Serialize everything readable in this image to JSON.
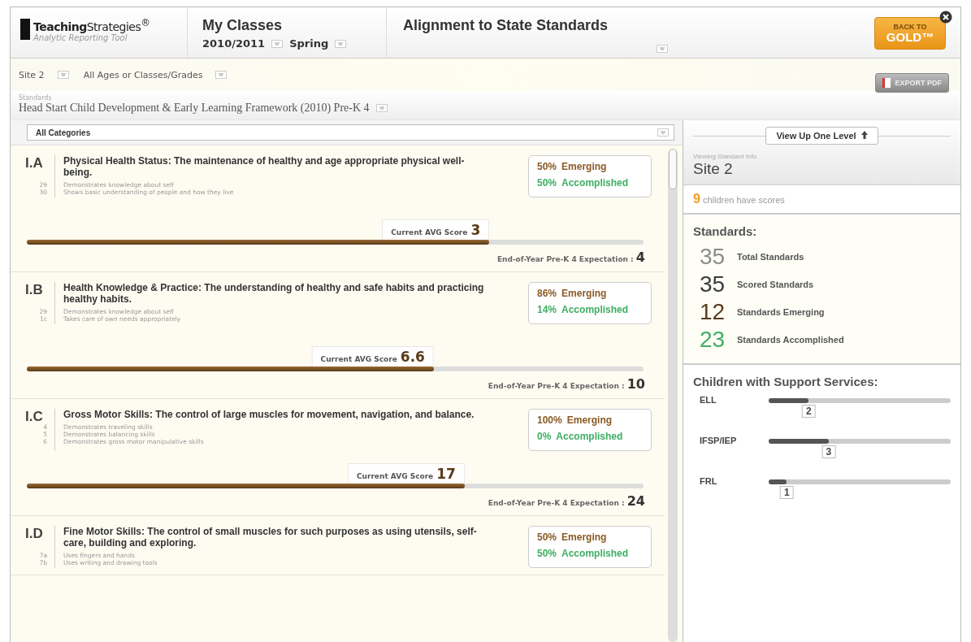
{
  "header": {
    "logo": "**Teaching**Strategies$^{®}$",
    "tagline": "Analytic Reporting Tool",
    "section_title": "My Classes",
    "year": "2010/2011",
    "term": "Spring",
    "report_title": "Alignment to State Standards",
    "back_button": [
      "BACK TO",
      "GOLD™"
    ]
  },
  "filters": [
    "Site 2",
    "All Ages or Classes/Grades"
  ],
  "export_button": "EXPORT PDF",
  "standards": {
    "label": "Standards",
    "value": "Head Start Child Development & Early Learning Framework (2010) Pre-K 4"
  },
  "category_select": "All Categories",
  "cards": [
    {
      "code": "I.A",
      "title": "Physical Health Status:  The maintenance of healthy and age appropriate physical well-being.",
      "indicators": [
        {
          "number": "29",
          "text": "Demonstrates knowledge about self"
        },
        {
          "number": "30",
          "text": "Shows basic understanding of people and how they live"
        }
      ],
      "emerging": "50%",
      "emerging_label": "Emerging",
      "accomplished": "50%",
      "accomplished_label": "Accomplished",
      "score_label": "Current AVG Score",
      "score": "3",
      "level": 0.75,
      "expectation_label": "End-of-Year Pre-K 4 Expectation :",
      "expectation": "4"
    },
    {
      "code": "I.B",
      "title": "Health Knowledge & Practice:  The understanding of healthy and safe habits and practicing healthy habits.",
      "indicators": [
        {
          "number": "29",
          "text": "Demonstrates knowledge about self"
        },
        {
          "number": "1c",
          "text": "Takes care of own needs appropriately"
        }
      ],
      "emerging": "86%",
      "emerging_label": "Emerging",
      "accomplished": "14%",
      "accomplished_label": "Accomplished",
      "score_label": "Current AVG Score",
      "score": "6.6",
      "level": 0.66,
      "expectation_label": "End-of-Year Pre-K 4 Expectation :",
      "expectation": "10"
    },
    {
      "code": "I.C",
      "title": "Gross Motor Skills:  The control of large muscles for movement, navigation, and balance.",
      "indicators": [
        {
          "number": "4",
          "text": "Demonstrates traveling skills"
        },
        {
          "number": "5",
          "text": "Demonstrates balancing skills"
        },
        {
          "number": "6",
          "text": "Demonstrates gross motor manipulative skills"
        }
      ],
      "emerging": "100%",
      "emerging_label": "Emerging",
      "accomplished": "0%",
      "accomplished_label": "Accomplished",
      "score_label": "Current AVG Score",
      "score": "17",
      "level": 0.71,
      "expectation_label": "End-of-Year Pre-K 4 Expectation :",
      "expectation": "24"
    },
    {
      "code": "I.D",
      "title": "Fine Motor Skills:  The control of small muscles for such purposes as using utensils, self-care, building and exploring.",
      "indicators": [
        {
          "number": "7a",
          "text": "Uses fingers and hands"
        },
        {
          "number": "7b",
          "text": "Uses writing and drawing tools"
        }
      ],
      "emerging": "50%",
      "emerging_label": "Emerging",
      "accomplished": "50%",
      "accomplished_label": "Accomplished"
    }
  ],
  "sidebar": {
    "view_up_button": "View Up One Level",
    "viewing_label": "Viewing Standard Info",
    "viewing_value": "Site 2",
    "children_count": "9",
    "children_text": "children have scores",
    "standards_title": "Standards:",
    "stats": [
      {
        "value": "35",
        "label": "Total Standards",
        "color": "#8c8c8c"
      },
      {
        "value": "35",
        "label": "Scored Standards",
        "color": "#3c3c3c"
      },
      {
        "value": "12",
        "label": "Standards Emerging",
        "color": "#5b3b1c"
      },
      {
        "value": "23",
        "label": "Standards Accomplished",
        "color": "#3fae62"
      }
    ],
    "support_title": "Children with Support Services:",
    "services": [
      {
        "label": "ELL",
        "count": "2",
        "level": 0.22
      },
      {
        "label": "IFSP/IEP",
        "count": "3",
        "level": 0.33
      },
      {
        "label": "FRL",
        "count": "1",
        "level": 0.1
      }
    ]
  }
}
